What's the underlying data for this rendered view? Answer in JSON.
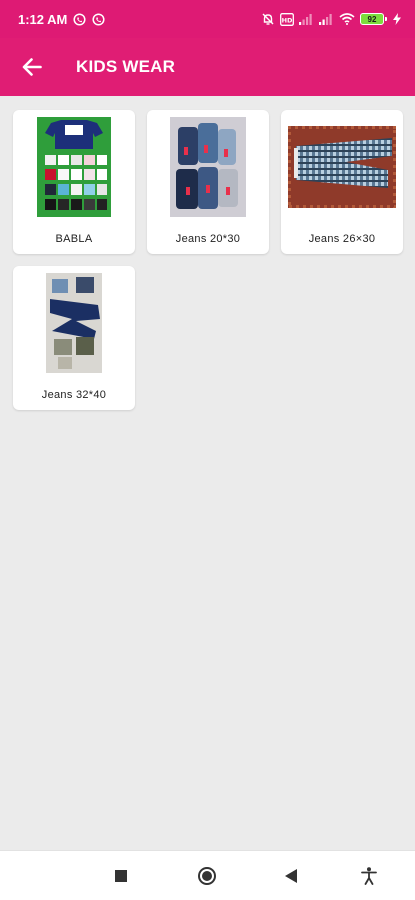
{
  "status_bar": {
    "time": "1:12 AM",
    "battery_level": "92",
    "left_icons": [
      "whatsapp-icon",
      "whatsapp-icon"
    ],
    "right_icons": [
      "alarm-off-icon",
      "hd-icon",
      "signal-icon",
      "signal-icon",
      "wifi-icon",
      "battery-icon",
      "charging-icon"
    ]
  },
  "app_bar": {
    "title": "KIDS WEAR",
    "background": "#e01d74",
    "back_icon": "arrow-left-icon"
  },
  "products": [
    {
      "label": "BABLA"
    },
    {
      "label": "Jeans 20*30"
    },
    {
      "label": "Jeans 26×30"
    },
    {
      "label": "Jeans 32*40"
    }
  ],
  "nav_bar": {
    "icons": [
      "recents-square-icon",
      "home-circle-icon",
      "back-triangle-icon",
      "accessibility-icon"
    ]
  }
}
